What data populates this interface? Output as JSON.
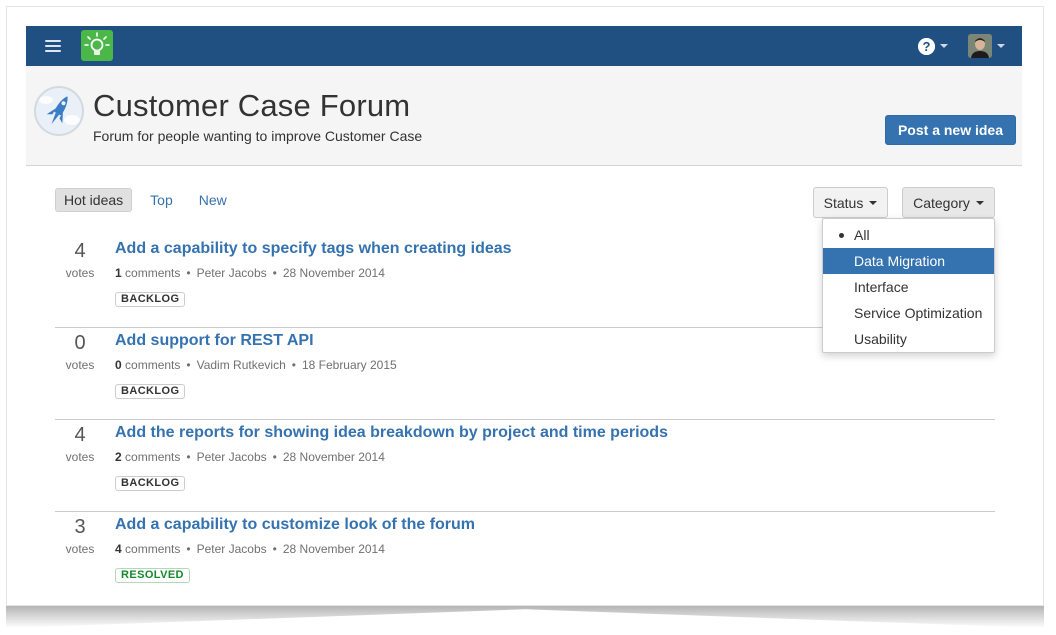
{
  "topbar": {
    "menu_icon": "hamburger-icon",
    "logo_icon": "lightbulb-icon",
    "help_icon": "help-icon",
    "user_avatar": "user-avatar"
  },
  "header": {
    "title": "Customer Case Forum",
    "subtitle": "Forum for people wanting to improve Customer Case",
    "post_button": "Post a new idea",
    "forum_icon": "rocket-icon"
  },
  "tabs": [
    {
      "label": "Hot ideas",
      "active": true
    },
    {
      "label": "Top",
      "active": false
    },
    {
      "label": "New",
      "active": false
    }
  ],
  "filters": {
    "status_label": "Status",
    "category_label": "Category",
    "category_options": [
      {
        "label": "All",
        "selected": true
      },
      {
        "label": "Data Migration",
        "highlighted": true
      },
      {
        "label": "Interface"
      },
      {
        "label": "Service Optimization"
      },
      {
        "label": "Usability"
      }
    ]
  },
  "ideas": [
    {
      "votes": "4",
      "votes_label": "votes",
      "title": "Add a capability to specify tags when creating ideas",
      "comments_count": "1",
      "comments_label": "comments",
      "author": "Peter Jacobs",
      "date": "28 November 2014",
      "status": "BACKLOG"
    },
    {
      "votes": "0",
      "votes_label": "votes",
      "title": "Add support for REST API",
      "comments_count": "0",
      "comments_label": "comments",
      "author": "Vadim Rutkevich",
      "date": "18 February 2015",
      "status": "BACKLOG"
    },
    {
      "votes": "4",
      "votes_label": "votes",
      "title": "Add the reports for showing idea breakdown by project and time periods",
      "comments_count": "2",
      "comments_label": "comments",
      "author": "Peter Jacobs",
      "date": "28 November 2014",
      "status": "BACKLOG"
    },
    {
      "votes": "3",
      "votes_label": "votes",
      "title": "Add a capability to customize look of the forum",
      "comments_count": "4",
      "comments_label": "comments",
      "author": "Peter Jacobs",
      "date": "28 November 2014",
      "status": "RESOLVED"
    }
  ],
  "colors": {
    "topbar": "#205081",
    "accent": "#3572b0",
    "logo_green": "#4bb749",
    "resolved": "#14892c"
  }
}
